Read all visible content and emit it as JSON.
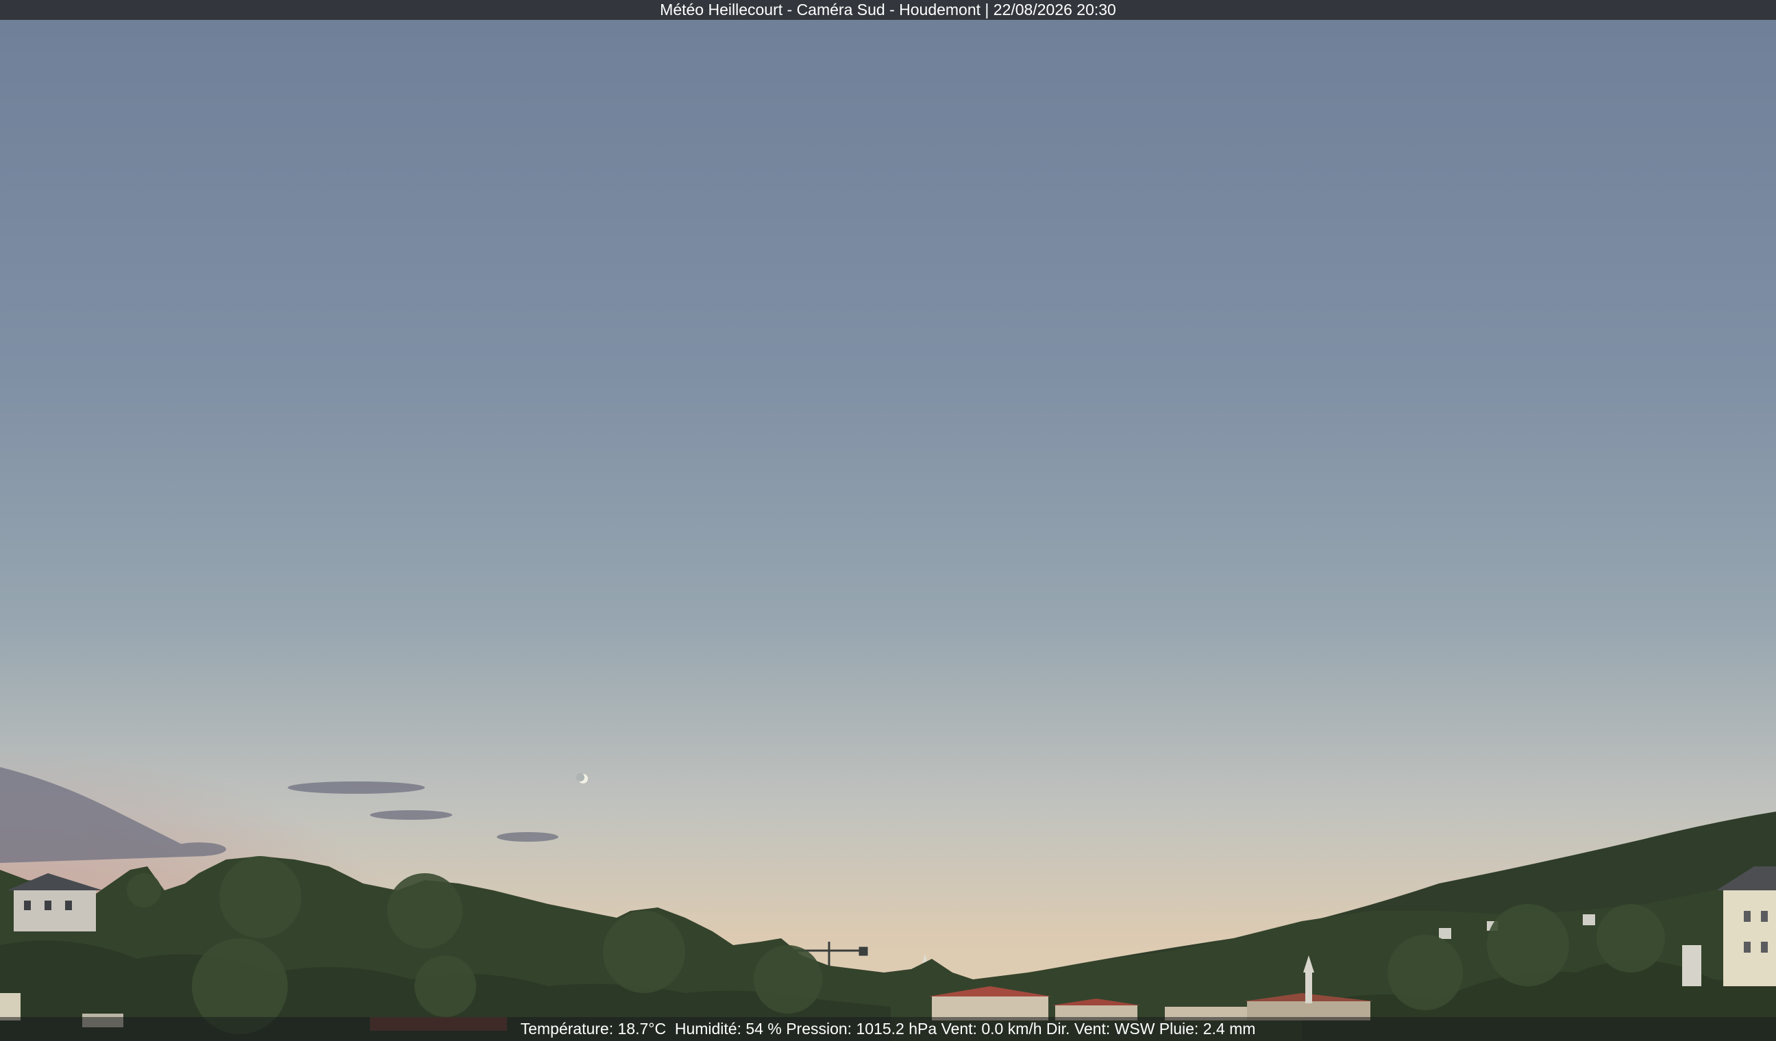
{
  "header": {
    "title": "Météo Heillecourt - Caméra Sud - Houdemont | 22/08/2026 20:30"
  },
  "weather_strip": {
    "text": "Température: 18.7°C  Humidité: 54 % Pression: 1015.2 hPa Vent: 0.0 km/h Dir. Vent: WSW Pluie: 2.4 mm"
  },
  "colors": {
    "sky_top": "#6f8099",
    "sky_mid": "#8a9aaa",
    "sky_horizon": "#d9c9b0",
    "sunset_glow": "#c79c93",
    "vegetation": "#3a4a30",
    "title_bar": "#33363c"
  }
}
